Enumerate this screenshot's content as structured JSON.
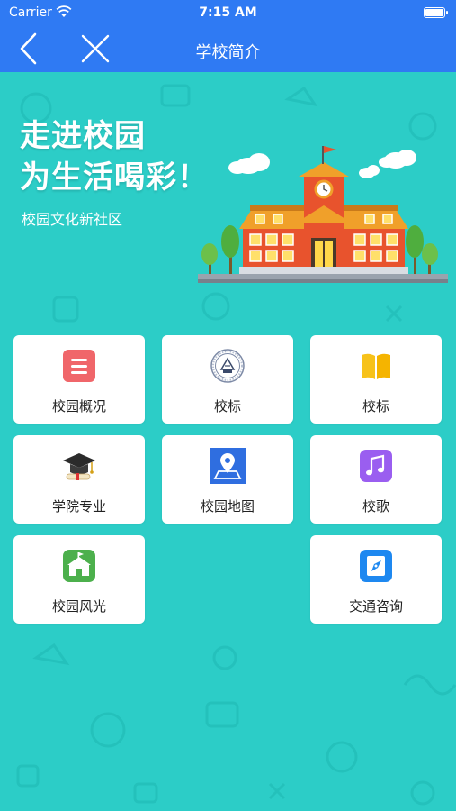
{
  "status_bar": {
    "carrier": "Carrier",
    "time": "7:15 AM"
  },
  "nav": {
    "title": "学校简介",
    "back_icon": "chevron-left-icon",
    "close_icon": "close-icon"
  },
  "banner": {
    "headline_line1": "走进校园",
    "headline_line2": "为生活喝彩！",
    "subtitle": "校园文化新社区"
  },
  "menu": [
    {
      "label": "校园概况",
      "icon": "document-list-icon",
      "color": "#f0666a"
    },
    {
      "label": "校标",
      "icon": "school-seal-icon",
      "color": "#9aa9c4"
    },
    {
      "label": "校标",
      "icon": "book-icon",
      "color": "#f7c21a"
    },
    {
      "label": "学院专业",
      "icon": "graduation-cap-icon",
      "color": "#333333"
    },
    {
      "label": "校园地图",
      "icon": "map-pin-icon",
      "color": "#2f6ee0"
    },
    {
      "label": "校歌",
      "icon": "music-note-icon",
      "color": "#9a5ef0"
    },
    {
      "label": "校园风光",
      "icon": "school-building-icon",
      "color": "#4cb04c"
    },
    {
      "label": "交通咨询",
      "icon": "compass-icon",
      "color": "#1e88f0"
    }
  ],
  "colors": {
    "nav_blue": "#2f7af3",
    "background_teal": "#2ccdc7"
  }
}
